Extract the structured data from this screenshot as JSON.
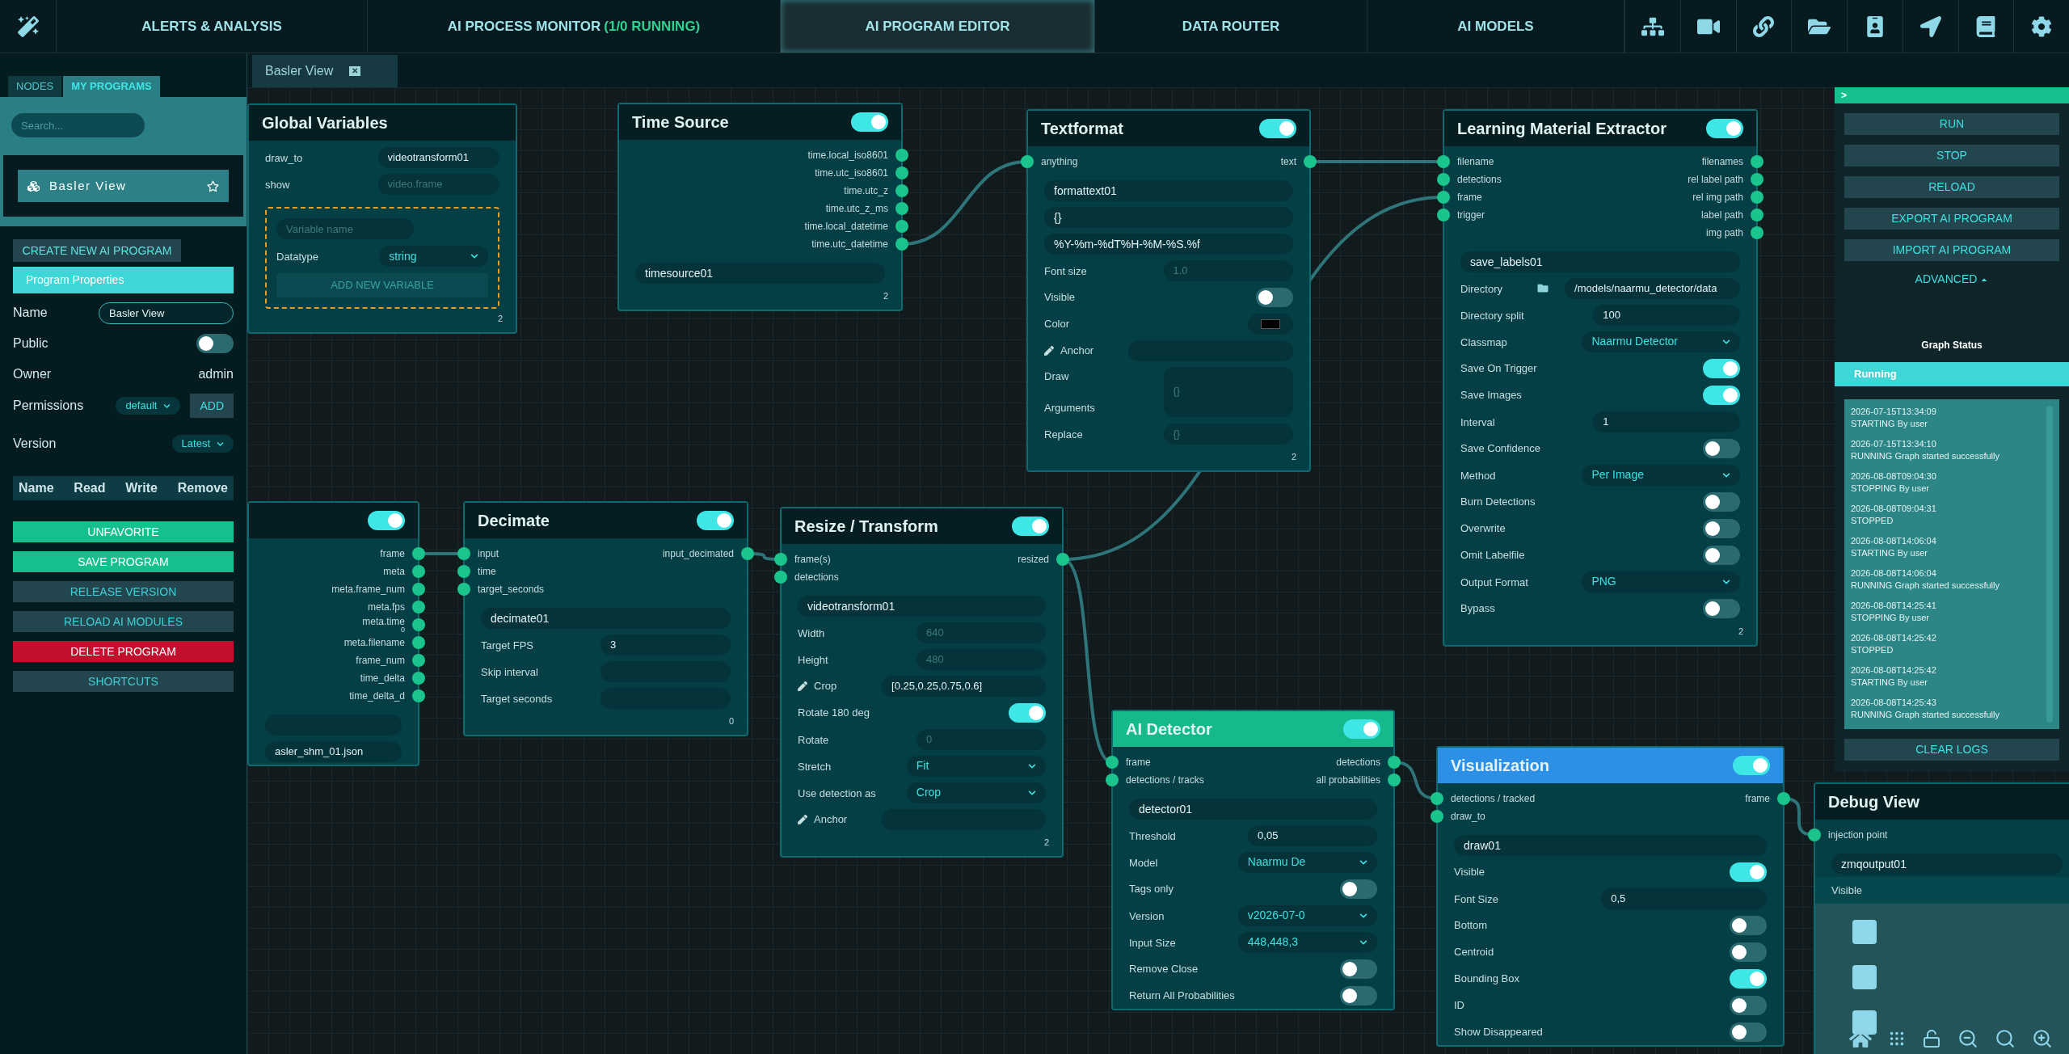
{
  "nav": {
    "tabs": [
      {
        "label": "ALERTS & ANALYSIS",
        "selected": false
      },
      {
        "label": "AI PROCESS MONITOR",
        "suffix": "(1/0 RUNNING)",
        "selected": false
      },
      {
        "label": "AI PROGRAM EDITOR",
        "selected": true
      },
      {
        "label": "DATA ROUTER",
        "selected": false
      },
      {
        "label": "AI MODELS",
        "selected": false
      }
    ]
  },
  "editor_tabs": [
    {
      "label": "Basler View",
      "close": "✕"
    }
  ],
  "sidebar": {
    "tabs": [
      {
        "label": "NODES",
        "selected": false
      },
      {
        "label": "MY PROGRAMS",
        "selected": true
      }
    ],
    "search": {
      "placeholder": "Search..."
    },
    "programs": [
      {
        "name": "Basler View"
      }
    ],
    "create_button": "CREATE NEW AI PROGRAM",
    "section_title": "Program Properties",
    "name": {
      "label": "Name",
      "value": "Basler View"
    },
    "public": {
      "label": "Public",
      "on": false
    },
    "owner": {
      "label": "Owner",
      "value": "admin"
    },
    "permissions": {
      "label": "Permissions",
      "value": "default",
      "button": "ADD"
    },
    "version": {
      "label": "Version",
      "value": "Latest"
    },
    "permission_columns": [
      "Name",
      "Read",
      "Write",
      "Remove"
    ],
    "actions": [
      {
        "label": "UNFAVORITE",
        "kind": "primary"
      },
      {
        "label": "SAVE PROGRAM",
        "kind": "primary"
      },
      {
        "label": "RELEASE VERSION",
        "kind": "secondary"
      },
      {
        "label": "RELOAD AI MODULES",
        "kind": "secondary"
      },
      {
        "label": "DELETE PROGRAM",
        "kind": "danger"
      },
      {
        "label": "SHORTCUTS",
        "kind": "secondary"
      }
    ]
  },
  "nodes": [
    {
      "title": "Global Variables",
      "fields": [
        {
          "kind": "input",
          "label": "draw_to",
          "value": "videotransform01"
        },
        {
          "kind": "input",
          "label": "show",
          "placeholder": "video.frame"
        },
        {
          "kind": "var_box",
          "placeholder": "Variable name",
          "label": "Datatype",
          "value": "string",
          "button": "ADD NEW VARIABLE"
        }
      ],
      "footer": "2"
    },
    {
      "title": "Time Source",
      "enabled": true,
      "outputs": [
        {
          "label": "time.local_iso8601"
        },
        {
          "label": "time.utc_iso8601"
        },
        {
          "label": "time.utc_z"
        },
        {
          "label": "time.utc_z_ms"
        },
        {
          "label": "time.local_datetime"
        },
        {
          "label": "time.utc_datetime"
        }
      ],
      "fields": [
        {
          "kind": "name",
          "value": "timesource01"
        }
      ],
      "footer": "2"
    },
    {
      "title": "Textformat",
      "enabled": true,
      "inputs": [
        "anything"
      ],
      "outputs": [
        {
          "label": "text"
        }
      ],
      "fields": [
        {
          "kind": "name",
          "value": "formattext01"
        },
        {
          "kind": "name",
          "value": "{}"
        },
        {
          "kind": "name",
          "value": "%Y-%m-%dT%H-%M-%S.%f"
        },
        {
          "kind": "input",
          "label": "Font size",
          "placeholder": "1.0"
        },
        {
          "kind": "toggle",
          "label": "Visible",
          "on": false
        },
        {
          "kind": "color",
          "label": "Color",
          "color": "#000000"
        },
        {
          "kind": "pen_input",
          "label": "Anchor"
        },
        {
          "kind": "area",
          "labels": [
            "Draw",
            "Arguments"
          ],
          "placeholder": "{}"
        },
        {
          "kind": "input",
          "label": "Replace",
          "placeholder": "{}"
        }
      ],
      "footer": "2"
    },
    {
      "title": "Learning Material Extractor",
      "enabled": true,
      "inputs": [
        "filename",
        "detections",
        "frame",
        "trigger"
      ],
      "outputs": [
        {
          "label": "filenames"
        },
        {
          "label": "rel label path"
        },
        {
          "label": "rel img path"
        },
        {
          "label": "label path"
        },
        {
          "label": "img path"
        }
      ],
      "fields": [
        {
          "kind": "name",
          "value": "save_labels01"
        },
        {
          "kind": "folder_input",
          "label": "Directory",
          "value": "/models/naarmu_detector/data"
        },
        {
          "kind": "input",
          "label": "Directory split",
          "value": "100"
        },
        {
          "kind": "select",
          "label": "Classmap",
          "value": "Naarmu Detector"
        },
        {
          "kind": "toggle",
          "label": "Save On Trigger",
          "on": true
        },
        {
          "kind": "toggle",
          "label": "Save Images",
          "on": true
        },
        {
          "kind": "input",
          "label": "Interval",
          "value": "1"
        },
        {
          "kind": "toggle",
          "label": "Save Confidence",
          "on": false
        },
        {
          "kind": "select",
          "label": "Method",
          "value": "Per Image"
        },
        {
          "kind": "toggle",
          "label": "Burn Detections",
          "on": false
        },
        {
          "kind": "toggle",
          "label": "Overwrite",
          "on": false
        },
        {
          "kind": "toggle",
          "label": "Omit Labelfile",
          "on": false
        },
        {
          "kind": "select",
          "label": "Output Format",
          "value": "PNG"
        },
        {
          "kind": "toggle",
          "label": "Bypass",
          "on": false
        }
      ],
      "footer": "2"
    },
    {
      "enabled": true,
      "outputs": [
        {
          "label": "frame"
        },
        {
          "label": "meta"
        },
        {
          "label": "meta.frame_num"
        },
        {
          "label": "meta.fps"
        },
        {
          "label": "meta.time",
          "sub": "0"
        },
        {
          "label": "meta.filename"
        },
        {
          "label": "frame_num"
        },
        {
          "label": "time_delta"
        },
        {
          "label": "time_delta_d"
        }
      ],
      "fields": [
        {
          "kind": "input"
        },
        {
          "kind": "input",
          "value": "asler_shm_01.json"
        }
      ]
    },
    {
      "title": "Decimate",
      "enabled": true,
      "inputs": [
        "input",
        "time",
        "target_seconds"
      ],
      "outputs": [
        {
          "label": "input_decimated"
        }
      ],
      "fields": [
        {
          "kind": "name",
          "value": "decimate01"
        },
        {
          "kind": "input",
          "label": "Target FPS",
          "value": "3"
        },
        {
          "kind": "input",
          "label": "Skip interval"
        },
        {
          "kind": "input",
          "label": "Target seconds"
        }
      ],
      "footer": "0"
    },
    {
      "title": "Resize / Transform",
      "enabled": true,
      "inputs": [
        "frame(s)",
        "detections"
      ],
      "outputs": [
        {
          "label": "resized"
        }
      ],
      "fields": [
        {
          "kind": "name",
          "value": "videotransform01"
        },
        {
          "kind": "input",
          "label": "Width",
          "placeholder": "640"
        },
        {
          "kind": "input",
          "label": "Height",
          "placeholder": "480"
        },
        {
          "kind": "pen_input",
          "label": "Crop",
          "value": "[0.25,0.25,0.75,0.6]"
        },
        {
          "kind": "toggle",
          "label": "Rotate 180 deg",
          "on": true
        },
        {
          "kind": "input",
          "label": "Rotate",
          "placeholder": "0"
        },
        {
          "kind": "select",
          "label": "Stretch",
          "value": "Fit"
        },
        {
          "kind": "select",
          "label": "Use detection as",
          "value": "Crop"
        },
        {
          "kind": "pen_input",
          "label": "Anchor"
        }
      ],
      "footer": "2"
    },
    {
      "title": "AI Detector",
      "color": "#15b98b",
      "enabled": true,
      "inputs": [
        "frame",
        "detections / tracks"
      ],
      "outputs": [
        {
          "label": "detections"
        },
        {
          "label": "all probabilities"
        }
      ],
      "fields": [
        {
          "kind": "name",
          "value": "detector01"
        },
        {
          "kind": "input",
          "label": "Threshold",
          "value": "0,05"
        },
        {
          "kind": "select",
          "label": "Model",
          "value": "Naarmu De"
        },
        {
          "kind": "toggle",
          "label": "Tags only",
          "on": false
        },
        {
          "kind": "select",
          "label": "Version",
          "value": "v2026-07-0"
        },
        {
          "kind": "select",
          "label": "Input Size",
          "value": "448,448,3"
        },
        {
          "kind": "toggle",
          "label": "Remove Close",
          "on": false
        },
        {
          "kind": "toggle",
          "label": "Return All Probabilities",
          "on": false
        }
      ]
    },
    {
      "title": "Visualization",
      "color": "#2b90e6",
      "enabled": true,
      "inputs": [
        "detections / tracked",
        "draw_to"
      ],
      "outputs": [
        {
          "label": "frame"
        }
      ],
      "fields": [
        {
          "kind": "name",
          "value": "draw01"
        },
        {
          "kind": "toggle",
          "label": "Visible",
          "on": true
        },
        {
          "kind": "input",
          "label": "Font Size",
          "value": "0,5"
        },
        {
          "kind": "toggle",
          "label": "Bottom",
          "on": false
        },
        {
          "kind": "toggle",
          "label": "Centroid",
          "on": false
        },
        {
          "kind": "toggle",
          "label": "Bounding Box",
          "on": true
        },
        {
          "kind": "toggle",
          "label": "ID",
          "on": false
        },
        {
          "kind": "toggle",
          "label": "Show Disappeared",
          "on": false
        }
      ]
    },
    {
      "title": "Debug View",
      "inputs": [
        "injection point"
      ],
      "fields": [
        {
          "kind": "name",
          "value": "zmqoutput01"
        },
        {
          "kind": "label",
          "label": "Visible"
        },
        {
          "kind": "preview"
        }
      ]
    }
  ],
  "control_panel": {
    "collapse": ">",
    "buttons": [
      "RUN",
      "STOP",
      "RELOAD",
      "EXPORT AI PROGRAM",
      "IMPORT AI PROGRAM"
    ],
    "advanced": "ADVANCED",
    "status_title": "Graph Status",
    "status": "Running",
    "logs": [
      {
        "time": "2026-07-15T13:34:09",
        "message": "STARTING By user"
      },
      {
        "time": "2026-07-15T13:34:10",
        "message": "RUNNING Graph started successfully"
      },
      {
        "time": "2026-08-08T09:04:30",
        "message": "STOPPING By user"
      },
      {
        "time": "2026-08-08T09:04:31",
        "message": "STOPPED"
      },
      {
        "time": "2026-08-08T14:06:04",
        "message": "STARTING By user"
      },
      {
        "time": "2026-08-08T14:06:04",
        "message": "RUNNING Graph started successfully"
      },
      {
        "time": "2026-08-08T14:25:41",
        "message": "STOPPING By user"
      },
      {
        "time": "2026-08-08T14:25:42",
        "message": "STOPPED"
      },
      {
        "time": "2026-08-08T14:25:42",
        "message": "STARTING By user"
      },
      {
        "time": "2026-08-08T14:25:43",
        "message": "RUNNING Graph started successfully"
      }
    ],
    "clear_button": "CLEAR LOGS"
  }
}
